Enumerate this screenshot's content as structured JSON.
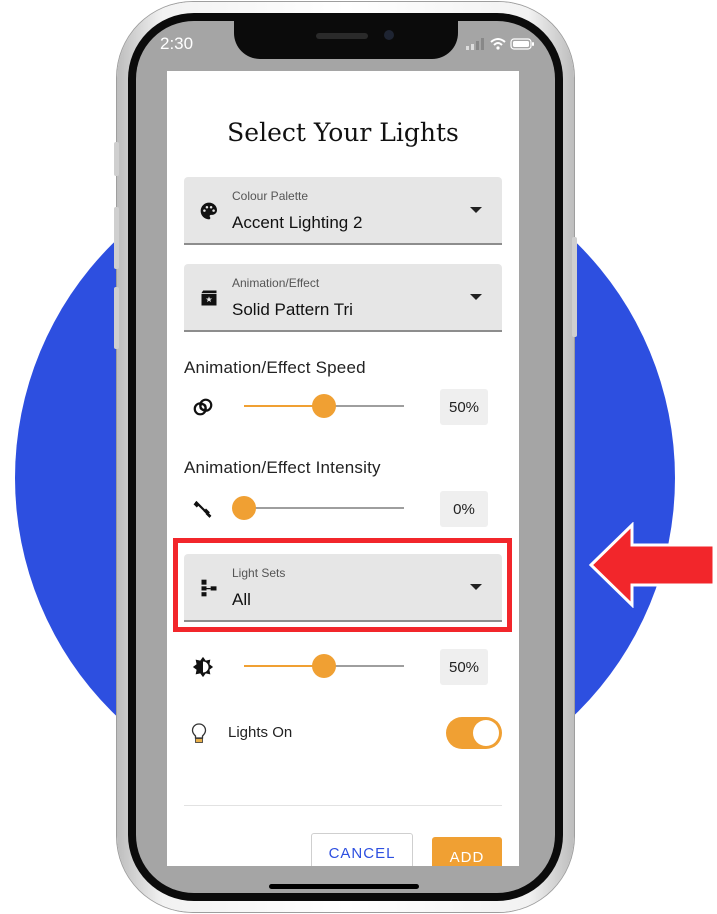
{
  "status_bar": {
    "time": "2:30"
  },
  "dialog": {
    "title": "Select Your Lights",
    "colour_palette": {
      "label": "Colour Palette",
      "value": "Accent Lighting 2",
      "icon": "palette-icon"
    },
    "animation_effect": {
      "label": "Animation/Effect",
      "value": "Solid Pattern Tri",
      "icon": "movie-icon"
    },
    "speed": {
      "label": "Animation/Effect Speed",
      "value_text": "50%",
      "value": 50,
      "icon": "rings-icon"
    },
    "intensity": {
      "label": "Animation/Effect Intensity",
      "value_text": "0%",
      "value": 0,
      "icon": "dumbbell-icon"
    },
    "light_sets": {
      "label": "Light Sets",
      "value": "All",
      "icon": "tree-structure-icon"
    },
    "brightness": {
      "value_text": "50%",
      "value": 50,
      "icon": "brightness-icon"
    },
    "lights_on": {
      "label": "Lights On",
      "on": true,
      "icon": "lightbulb-icon"
    },
    "buttons": {
      "cancel": "CANCEL",
      "add": "ADD"
    }
  },
  "colors": {
    "accent": "#f0a033",
    "circle": "#2d4fe0",
    "highlight": "#f2262b",
    "button_text": "#2d4fe0"
  }
}
